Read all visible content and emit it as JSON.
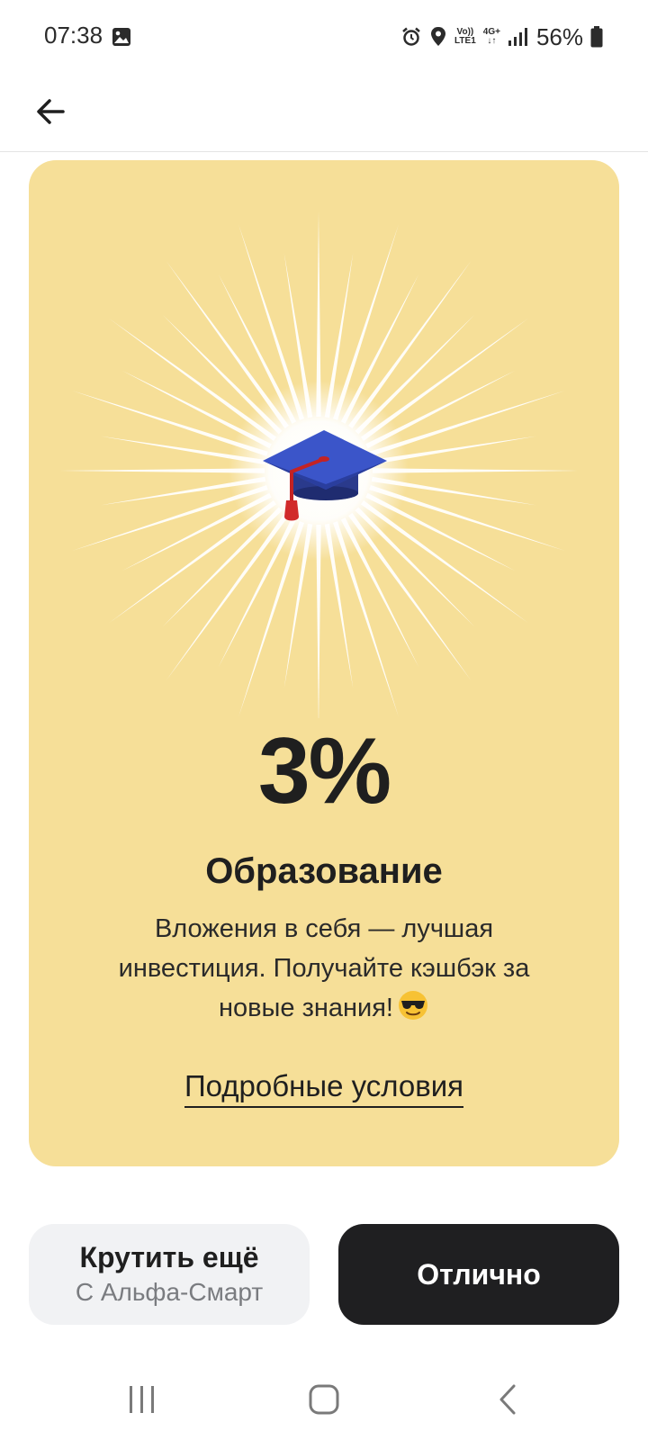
{
  "status_bar": {
    "time": "07:38",
    "network": "4G+",
    "network_sub": "LTE1",
    "volte": "Vo))",
    "battery": "56%",
    "icons": [
      "gallery-icon",
      "alarm-icon",
      "location-icon",
      "volte-icon",
      "4g-icon",
      "signal-icon",
      "battery-icon"
    ]
  },
  "app_bar": {
    "back_icon": "arrow-left-icon"
  },
  "card": {
    "background": "#f6df98",
    "icon": "graduation-cap-icon",
    "percent": "3%",
    "title": "Образование",
    "description": "Вложения в себя — лучшая инвестиция. Получайте кэшбэк за новые знания!",
    "description_emoji": "sunglasses-emoji",
    "terms_link": "Подробные условия"
  },
  "buttons": {
    "secondary_label": "Крутить ещё",
    "secondary_sublabel": "С Альфа-Смарт",
    "primary_label": "Отлично",
    "primary_color": "#1f1f21"
  },
  "nav_bar": {
    "items": [
      "recent-apps-icon",
      "home-icon",
      "back-icon"
    ]
  }
}
